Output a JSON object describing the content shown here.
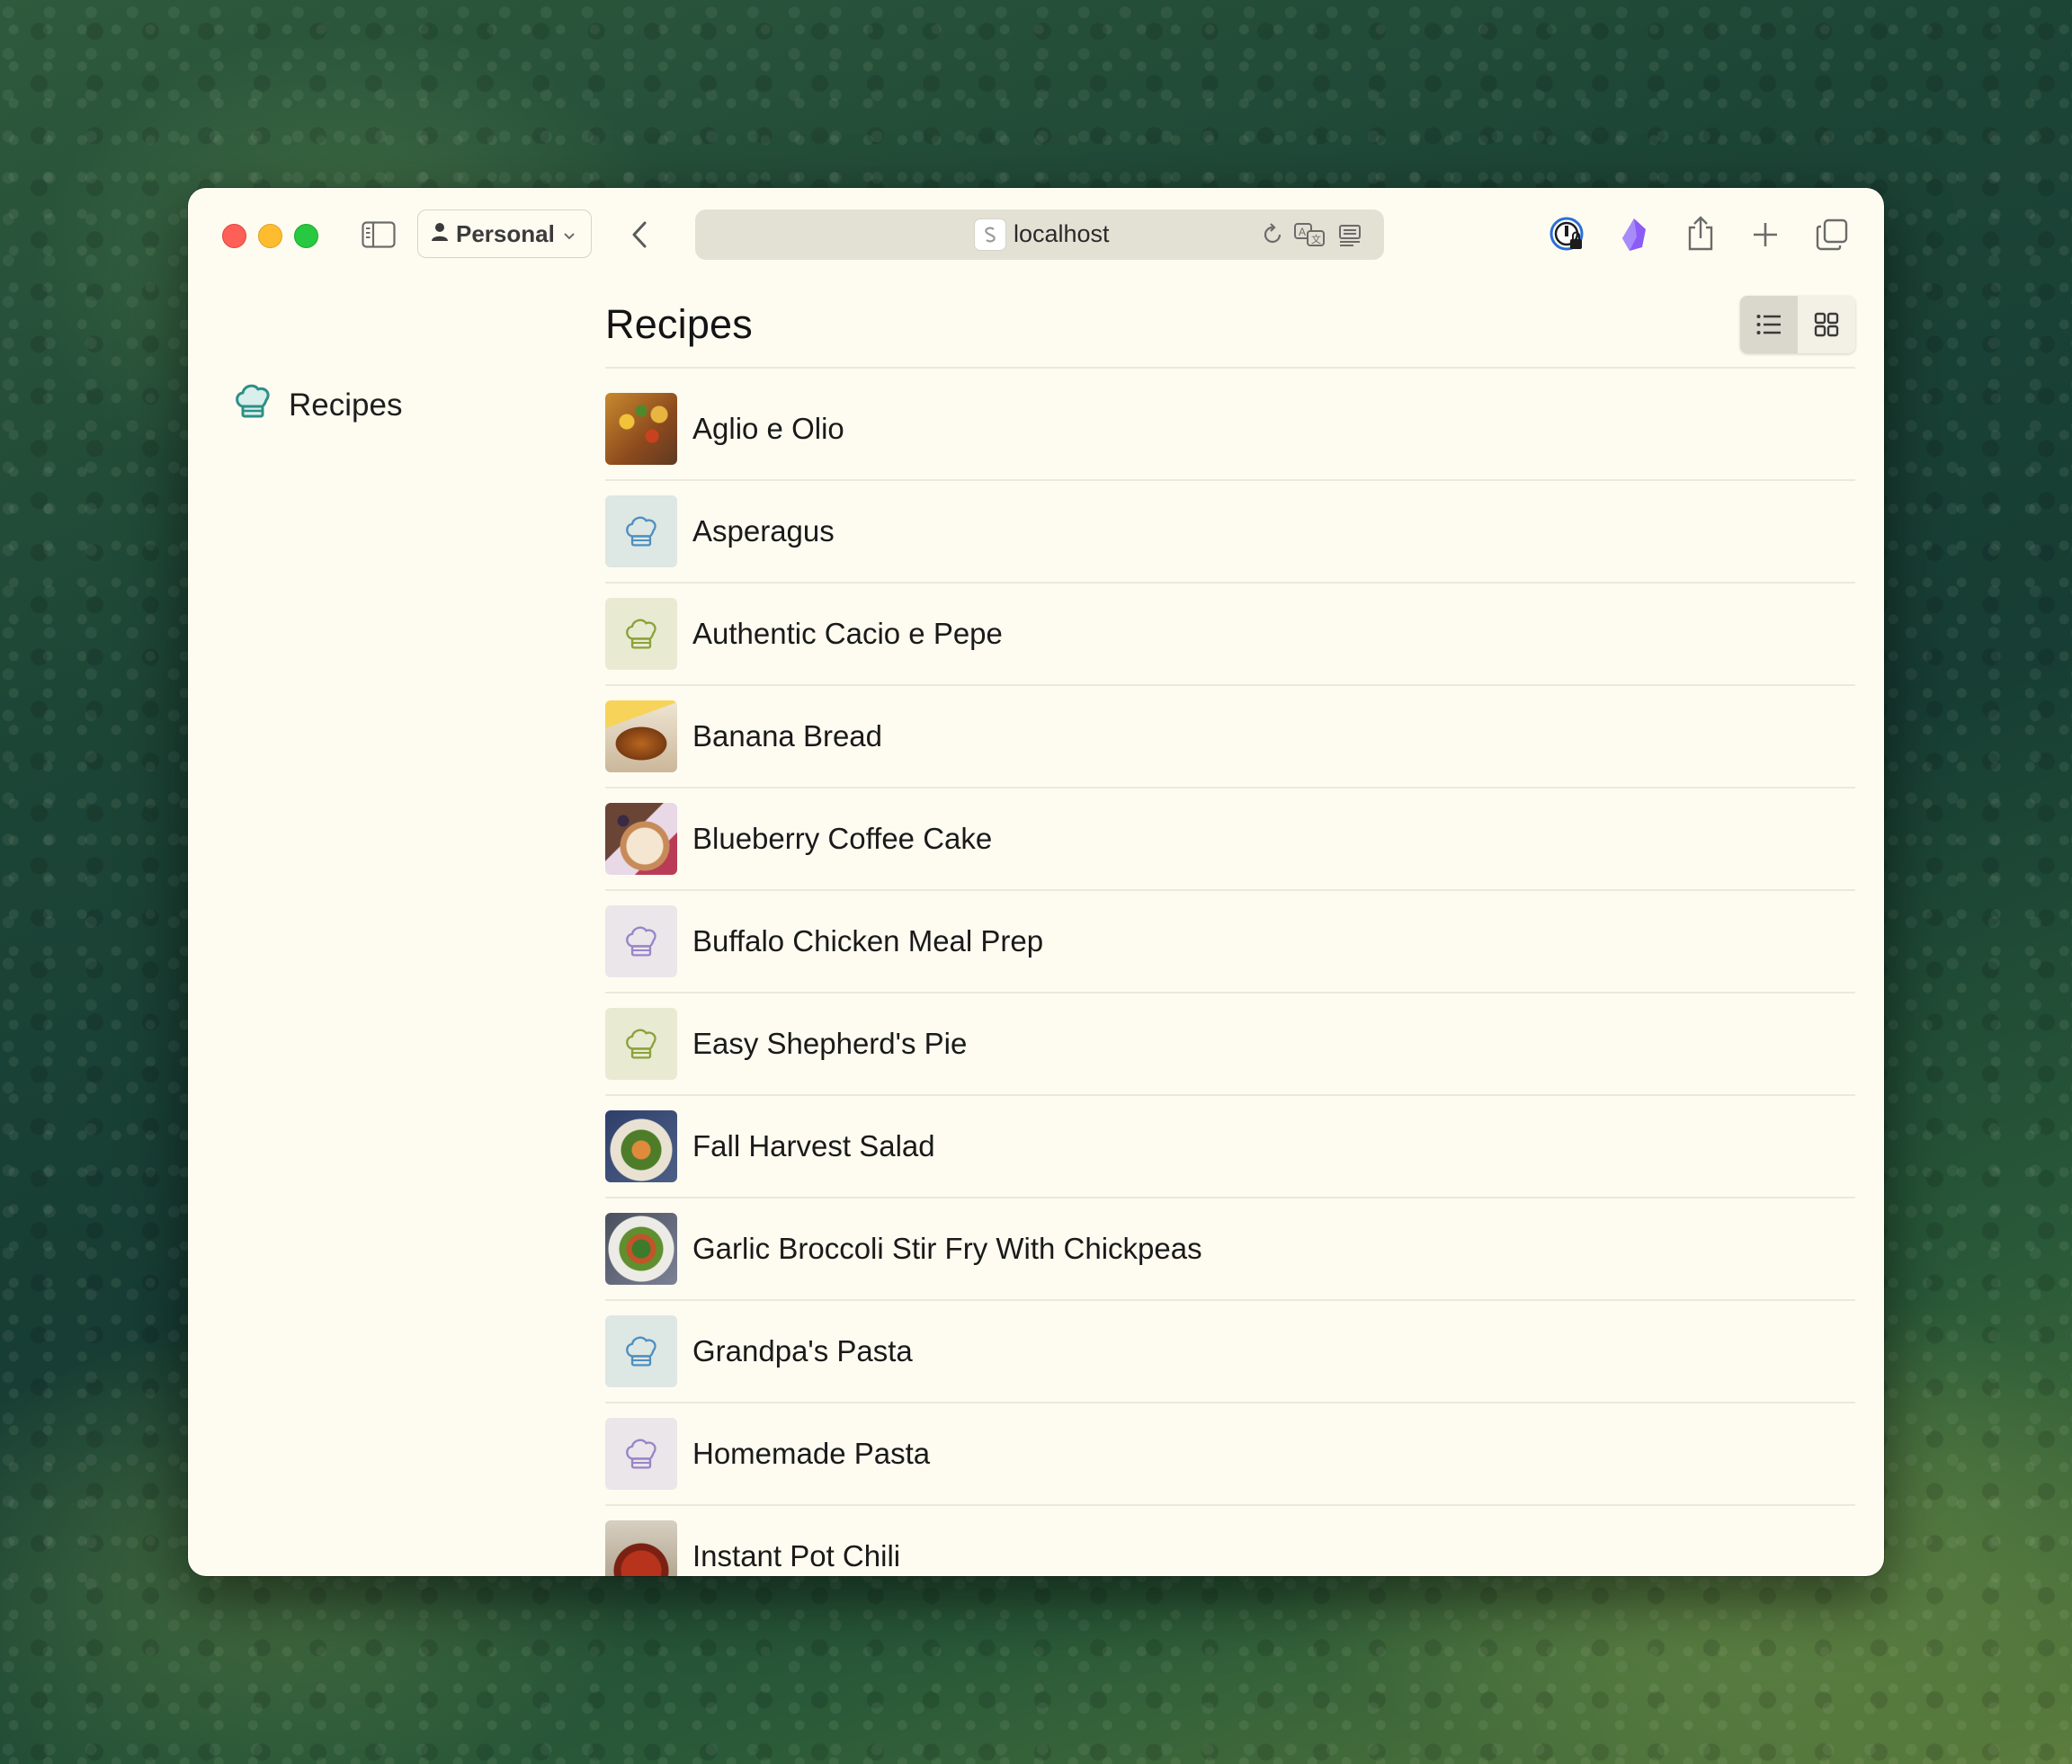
{
  "browser": {
    "profile_label": "Personal",
    "url": "localhost"
  },
  "sidebar": {
    "items": [
      {
        "label": "Recipes",
        "icon": "chef-hat-icon"
      }
    ]
  },
  "main": {
    "title": "Recipes",
    "view_modes": [
      "list",
      "grid"
    ],
    "active_view": "list",
    "recipes": [
      {
        "name": "Aglio e Olio",
        "thumb": "photo-aglio"
      },
      {
        "name": "Asperagus",
        "thumb": "placeholder-blue"
      },
      {
        "name": "Authentic Cacio e Pepe",
        "thumb": "placeholder-green"
      },
      {
        "name": "Banana Bread",
        "thumb": "photo-banana"
      },
      {
        "name": "Blueberry Coffee Cake",
        "thumb": "photo-blueberry"
      },
      {
        "name": "Buffalo Chicken Meal Prep",
        "thumb": "placeholder-purple"
      },
      {
        "name": "Easy Shepherd's Pie",
        "thumb": "placeholder-green"
      },
      {
        "name": "Fall Harvest Salad",
        "thumb": "photo-fall"
      },
      {
        "name": "Garlic Broccoli Stir Fry With Chickpeas",
        "thumb": "photo-garlic"
      },
      {
        "name": "Grandpa's Pasta",
        "thumb": "placeholder-blue"
      },
      {
        "name": "Homemade Pasta",
        "thumb": "placeholder-purple"
      },
      {
        "name": "Instant Pot Chili",
        "thumb": "photo-chili"
      }
    ]
  },
  "colors": {
    "accent_teal": "#2f8f86",
    "placeholder_blue_icon": "#4f8fc0",
    "placeholder_green_icon": "#8aa23a",
    "placeholder_purple_icon": "#9a84c8",
    "window_background": "#fefcf1"
  }
}
